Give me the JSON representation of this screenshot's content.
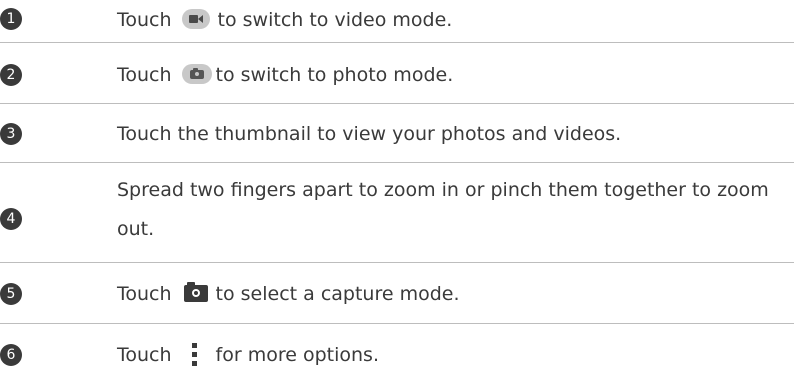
{
  "steps": [
    {
      "number": "1",
      "before": "Touch",
      "icon": "video-camera-icon",
      "after": "to switch to video mode."
    },
    {
      "number": "2",
      "before": "Touch",
      "icon": "photo-camera-icon",
      "after": "to switch to photo mode."
    },
    {
      "number": "3",
      "text": "Touch the thumbnail to view your photos and videos."
    },
    {
      "number": "4",
      "text": "Spread two fingers apart to zoom in or pinch them together to zoom out."
    },
    {
      "number": "5",
      "before": "Touch",
      "icon": "capture-mode-camera-icon",
      "after": "to select a capture mode."
    },
    {
      "number": "6",
      "before": "Touch",
      "icon": "more-options-icon",
      "after": "for more options."
    }
  ]
}
